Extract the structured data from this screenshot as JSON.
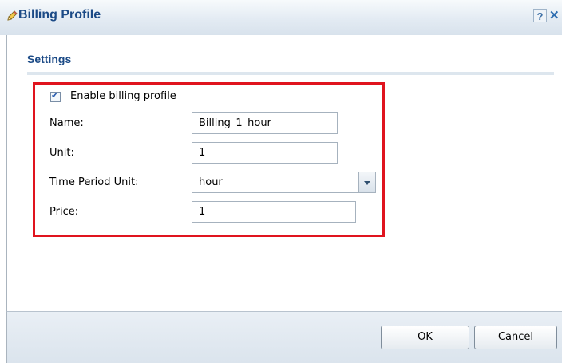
{
  "dialog": {
    "title": "Billing Profile",
    "help_label": "?",
    "close_label": "✕",
    "title_icon": "pencil-icon"
  },
  "settings": {
    "section_title": "Settings",
    "enable_label": "Enable billing profile",
    "enable_checked": true,
    "name_label": "Name:",
    "name_value": "Billing_1_hour",
    "unit_label": "Unit:",
    "unit_value": "1",
    "time_period_label": "Time Period Unit:",
    "time_period_value": "hour",
    "price_label": "Price:",
    "price_value": "1"
  },
  "footer": {
    "ok_label": "OK",
    "cancel_label": "Cancel"
  },
  "colors": {
    "highlight": "#e0141e",
    "title_text": "#1b4a86"
  }
}
